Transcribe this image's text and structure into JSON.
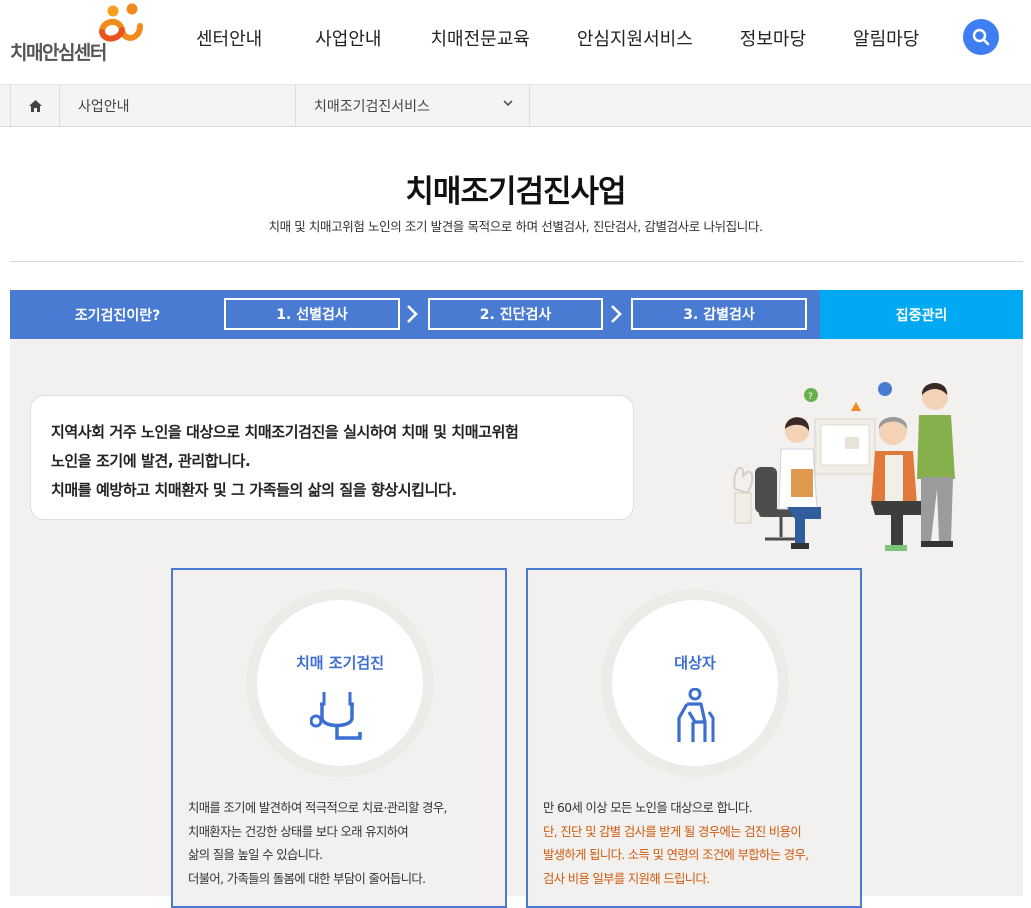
{
  "header": {
    "logo_text": "치매안심센터",
    "nav": [
      "센터안내",
      "사업안내",
      "치매전문교육",
      "안심지원서비스",
      "정보마당",
      "알림마당"
    ],
    "search_icon": "search-icon"
  },
  "breadcrumb": {
    "home_icon": "home-icon",
    "level1": "사업안내",
    "level2": "치매조기검진서비스"
  },
  "page": {
    "title": "치매조기검진사업",
    "subtitle": "치매 및 치매고위험 노인의 조기 발견을 목적으로 하며 선별검사, 진단검사, 감별검사로 나뉘집니다."
  },
  "steps": {
    "intro": "조기검진이란?",
    "step1": "1. 선별검사",
    "step2": "2. 진단검사",
    "step3": "3. 감별검사",
    "last": "집중관리"
  },
  "intro": {
    "line1": "지역사회 거주 노인을 대상으로 치매조기검진을 실시하여 치매 및 치매고위험",
    "line2": "노인을 조기에 발견, 관리합니다.",
    "line3": "치매를 예방하고 치매환자 및 그 가족들의 삶의 질을 향상시킵니다."
  },
  "cards": [
    {
      "label": "치매 조기검진",
      "icon": "stethoscope-icon",
      "lines": [
        "치매를 조기에 발견하여 적극적으로 치료·관리할 경우,",
        "치매환자는 건강한 상태를 보다 오래 유지하여",
        "삶의 질을 높일 수 있습니다.",
        "더불어, 가족들의 돌봄에 대한 부담이 줄어듭니다."
      ]
    },
    {
      "label": "대상자",
      "icon": "elderly-person-icon",
      "line1": "만 60세 이상 모든 노인을 대상으로 합니다.",
      "highlight": [
        "단, 진단 및 감별 검사를 받게 될 경우에는 검진 비용이",
        "발생하게 됩니다. 소득 및 연령의 조건에 부합하는 경우,",
        "검사 비용 일부를 지원해 드립니다."
      ]
    }
  ],
  "colors": {
    "primary_blue": "#4a7bd2",
    "sky_blue": "#00a9f2",
    "search_blue": "#3f7ef2",
    "highlight_orange": "#d05a0e",
    "content_bg": "#f2f1ef"
  }
}
